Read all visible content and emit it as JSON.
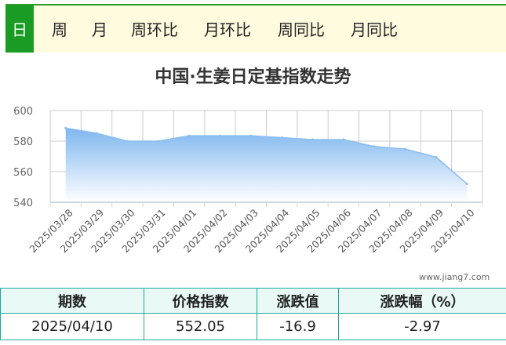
{
  "tabs": [
    {
      "label": "日",
      "active": true
    },
    {
      "label": "周",
      "active": false
    },
    {
      "label": "月",
      "active": false
    },
    {
      "label": "周环比",
      "active": false
    },
    {
      "label": "月环比",
      "active": false
    },
    {
      "label": "周同比",
      "active": false
    },
    {
      "label": "月同比",
      "active": false
    }
  ],
  "watermark": "www.jiang7.com",
  "chart_data": {
    "type": "area",
    "title": "中国·生姜日定基指数走势",
    "xlabel": "",
    "ylabel": "",
    "categories": [
      "2025/03/28",
      "2025/03/29",
      "2025/03/30",
      "2025/03/31",
      "2025/04/01",
      "2025/04/02",
      "2025/04/03",
      "2025/04/04",
      "2025/04/05",
      "2025/04/06",
      "2025/04/07",
      "2025/04/08",
      "2025/04/09",
      "2025/04/10"
    ],
    "values": [
      588.5,
      585.2,
      580.0,
      580.0,
      583.5,
      583.5,
      583.5,
      582.3,
      581.0,
      581.0,
      576.5,
      574.8,
      569.5,
      552.05
    ],
    "yticks": [
      540,
      560,
      580,
      600
    ],
    "ylim": [
      540,
      600
    ],
    "grid": true,
    "colors": {
      "line": "#8bbef0",
      "fill_top": "#7fb6ef",
      "fill_bottom": "#ffffff",
      "grid": "#cccccc",
      "axis": "#cfd8e0"
    }
  },
  "table": {
    "headers": [
      "期数",
      "价格指数",
      "涨跌值",
      "涨跌幅（%）"
    ],
    "rows": [
      [
        "2025/04/10",
        "552.05",
        "-16.9",
        "-2.97"
      ]
    ]
  }
}
